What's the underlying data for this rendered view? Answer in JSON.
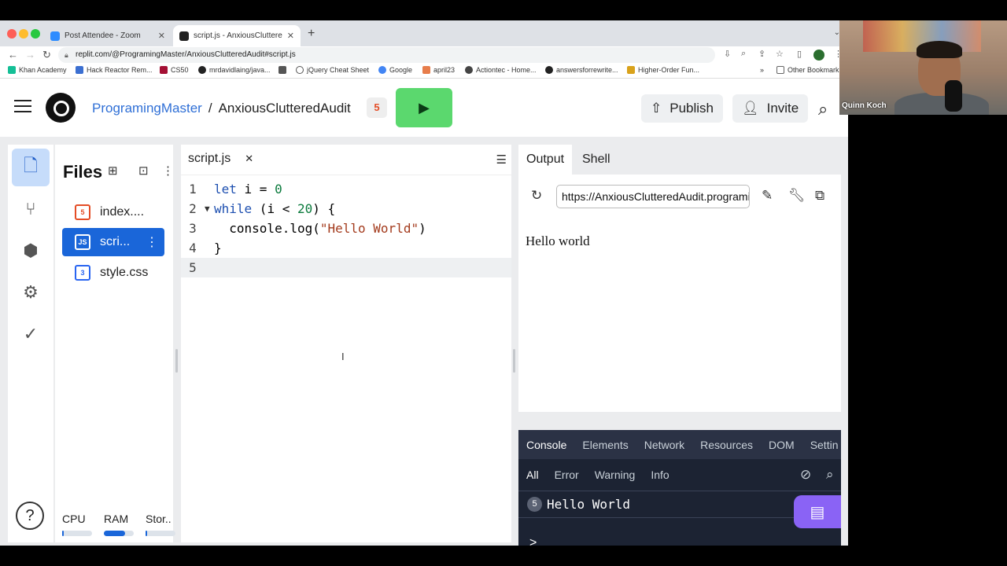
{
  "browser": {
    "tabs": [
      {
        "title": "Post Attendee - Zoom"
      },
      {
        "title": "script.js - AnxiousClutteredAu"
      }
    ],
    "url": "replit.com/@ProgramingMaster/AnxiousClutteredAudit#script.js",
    "bookmarks": [
      {
        "label": "Khan Academy"
      },
      {
        "label": "Hack Reactor Rem..."
      },
      {
        "label": "CS50"
      },
      {
        "label": "mrdavidlaing/java..."
      },
      {
        "label": ""
      },
      {
        "label": "jQuery Cheat Sheet"
      },
      {
        "label": "Google"
      },
      {
        "label": "april23"
      },
      {
        "label": "Actiontec - Home..."
      },
      {
        "label": "answersforrewrite..."
      },
      {
        "label": "Higher-Order Fun..."
      }
    ],
    "more_bookmarks": "»",
    "other_bookmarks": "Other Bookmark"
  },
  "header": {
    "user": "ProgramingMaster",
    "separator": "/",
    "project": "AnxiousClutteredAudit",
    "publish_label": "Publish",
    "invite_label": "Invite"
  },
  "files": {
    "title": "Files",
    "items": [
      {
        "name": "index....",
        "badge": "5",
        "color": "#e44d26"
      },
      {
        "name": "scri...",
        "badge": "JS",
        "color": "#ffffff"
      },
      {
        "name": "style.css",
        "badge": "3",
        "color": "#2965f1"
      }
    ]
  },
  "resources": {
    "cpu_label": "CPU",
    "ram_label": "RAM",
    "storage_label": "Stor..",
    "cpu_level": 0.05,
    "ram_level": 0.7,
    "storage_level": 0.05
  },
  "editor": {
    "tab_label": "script.js",
    "lines": [
      {
        "n": "1",
        "text": "let i = 0"
      },
      {
        "n": "2",
        "text": "while (i < 20) {"
      },
      {
        "n": "3",
        "text": "console.log(\"Hello World\")"
      },
      {
        "n": "4",
        "text": "}"
      },
      {
        "n": "5",
        "text": ""
      }
    ]
  },
  "output": {
    "tab_output": "Output",
    "tab_shell": "Shell",
    "url": "https://AnxiousClutteredAudit.programingmaster.repl.co",
    "text": "Hello world"
  },
  "devtools": {
    "tabs": [
      "Console",
      "Elements",
      "Network",
      "Resources",
      "DOM",
      "Settin"
    ],
    "filters": [
      "All",
      "Error",
      "Warning",
      "Info"
    ],
    "log_count": "5",
    "log_text": "Hello World",
    "prompt": ">"
  },
  "webcam": {
    "name": "Quinn Koch"
  },
  "colors": {
    "accent": "#1a66d9",
    "run": "#5bd86e",
    "chat": "#8a63f5"
  }
}
